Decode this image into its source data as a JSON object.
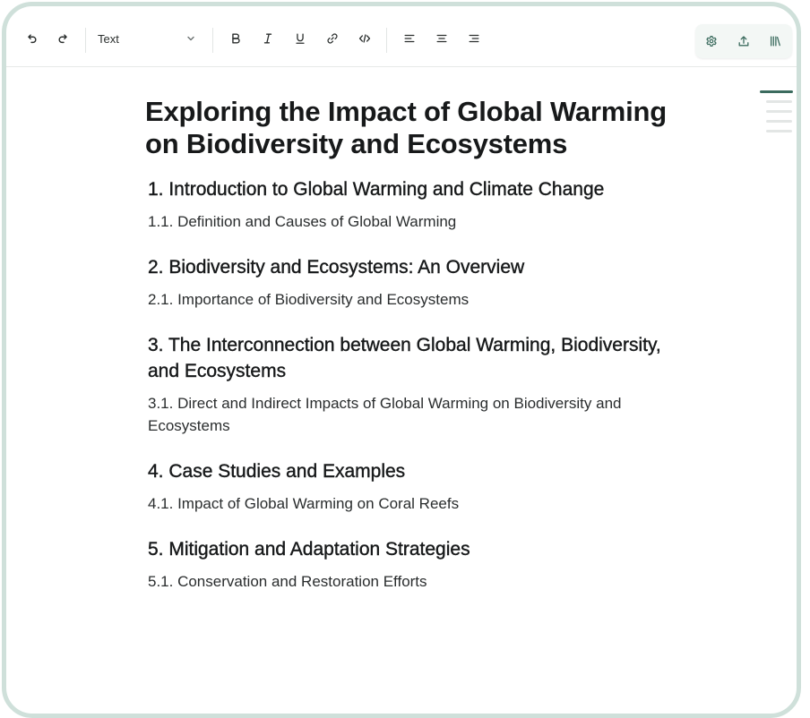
{
  "toolbar": {
    "text_style_label": "Text",
    "undo_icon": "undo-icon",
    "redo_icon": "redo-icon",
    "bold_icon": "bold-icon",
    "italic_icon": "italic-icon",
    "underline_icon": "underline-icon",
    "link_icon": "link-icon",
    "code_icon": "code-icon",
    "align_left_icon": "align-left-icon",
    "align_center_icon": "align-center-icon",
    "align_right_icon": "align-right-icon",
    "settings_icon": "gear-icon",
    "export_icon": "upload-icon",
    "library_icon": "library-icon",
    "accent_color": "#3b6b5e"
  },
  "document": {
    "title": "Exploring the Impact of Global Warming on Biodiversity and Ecosystems",
    "sections": [
      {
        "heading": "1. Introduction to Global Warming and Climate Change",
        "subheading": "1.1. Definition and Causes of Global Warming"
      },
      {
        "heading": "2. Biodiversity and Ecosystems: An Overview",
        "subheading": "2.1. Importance of Biodiversity and Ecosystems"
      },
      {
        "heading": "3. The Interconnection between Global Warming, Biodiversity, and Ecosystems",
        "subheading": "3.1. Direct and Indirect Impacts of Global Warming on Biodiversity and Ecosystems"
      },
      {
        "heading": "4. Case Studies and Examples",
        "subheading": "4.1. Impact of Global Warming on Coral Reefs"
      },
      {
        "heading": "5. Mitigation and Adaptation Strategies",
        "subheading": "5.1. Conservation and Restoration Efforts"
      }
    ]
  }
}
